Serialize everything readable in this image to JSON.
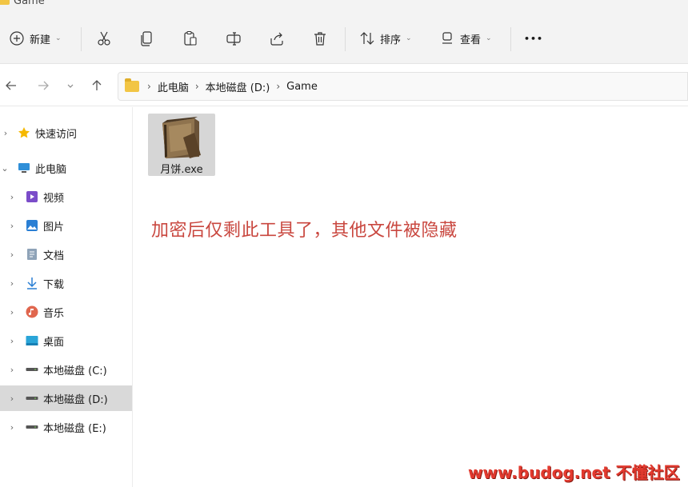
{
  "window": {
    "title": "Game"
  },
  "toolbar": {
    "new_label": "新建",
    "sort_label": "排序",
    "view_label": "查看",
    "more_label": "•••"
  },
  "address": {
    "crumbs": [
      "此电脑",
      "本地磁盘 (D:)",
      "Game"
    ]
  },
  "sidebar": {
    "items": [
      {
        "label": "快速访问"
      },
      {
        "label": "此电脑"
      },
      {
        "label": "视频"
      },
      {
        "label": "图片"
      },
      {
        "label": "文档"
      },
      {
        "label": "下载"
      },
      {
        "label": "音乐"
      },
      {
        "label": "桌面"
      },
      {
        "label": "本地磁盘 (C:)"
      },
      {
        "label": "本地磁盘 (D:)"
      },
      {
        "label": "本地磁盘 (E:)"
      }
    ]
  },
  "main": {
    "file_name": "月饼.exe",
    "note": "加密后仅剩此工具了，其他文件被隐藏",
    "watermark": "www.budog.net 不懂社区"
  },
  "colors": {
    "note": "#c9473f",
    "watermark": "#e23a2f",
    "folder": "#f2c544",
    "selected_row": "#d9d9d9"
  }
}
